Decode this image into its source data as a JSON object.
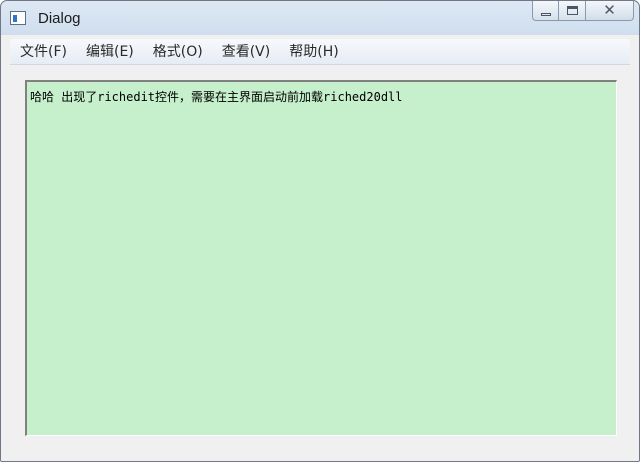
{
  "window": {
    "title": "Dialog",
    "icon": "app-window-icon"
  },
  "caption_buttons": {
    "minimize_icon": "minimize-icon",
    "maximize_icon": "maximize-icon",
    "close_icon": "close-icon",
    "close_glyph": "✕"
  },
  "menu": {
    "items": [
      {
        "label": "文件(F)"
      },
      {
        "label": "编辑(E)"
      },
      {
        "label": "格式(O)"
      },
      {
        "label": "查看(V)"
      },
      {
        "label": "帮助(H)"
      }
    ]
  },
  "richedit": {
    "text": "哈哈 出现了richedit控件，需要在主界面启动前加载riched20dll",
    "background": "#c6efcc"
  }
}
